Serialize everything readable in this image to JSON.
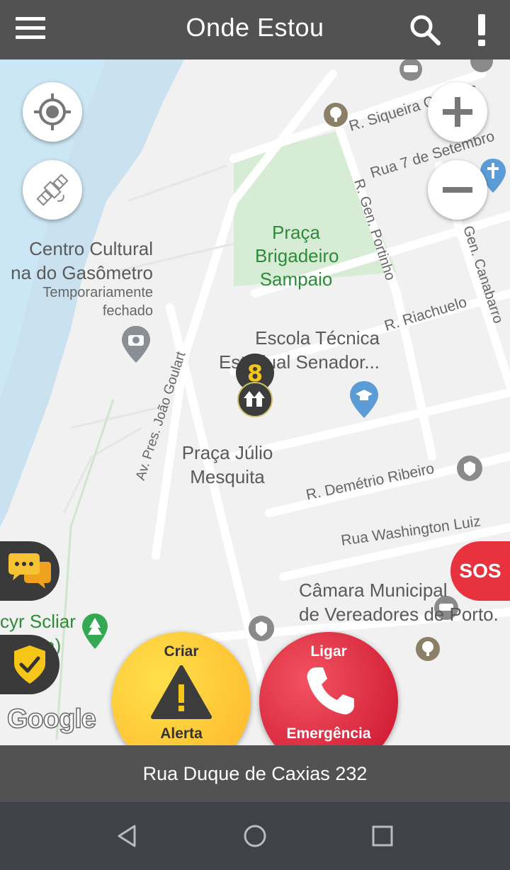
{
  "header": {
    "title": "Onde Estou",
    "menu_icon": "hamburger-menu-icon",
    "search_icon": "search-icon",
    "more_icon": "exclamation-icon"
  },
  "map": {
    "streets": {
      "siqueira_campos": "R. Siqueira Campos",
      "sete_setembro": "Rua 7 de Setembro",
      "gen_portinho": "R. Gen. Portinho",
      "gen_canabarro": "Gen. Canabarro",
      "riachuelo": "R. Riachuelo",
      "joao_goulart": "Av. Pres. João Goulart",
      "demetrio_ribeiro": "R. Demétrio Ribeiro",
      "washington_luiz": "Rua Washington Luiz"
    },
    "places": {
      "praca_brigadeiro": [
        "Praça",
        "Brigadeiro",
        "Sampaio"
      ],
      "centro_cultural": [
        "Centro Cultural",
        "na do Gasômetro"
      ],
      "centro_cultural_status": [
        "Temporariamente",
        "fechado"
      ],
      "escola": [
        "Escola Técnica",
        "Estadual Senador..."
      ],
      "praca_julio": [
        "Praça Júlio",
        "Mesquita"
      ],
      "camara": [
        "Câmara Municipal",
        "de Vereadores de Porto."
      ],
      "scliar": [
        "cyr Scliar",
        "(ha)"
      ]
    },
    "attribution": "Google"
  },
  "controls": {
    "locate_icon": "my-location-icon",
    "satellite_icon": "satellite-icon",
    "zoom_in_icon": "plus-icon",
    "zoom_out_icon": "minus-icon",
    "chat_icon": "chat-bubbles-icon",
    "shield_icon": "shield-check-icon",
    "sos_label": "SOS"
  },
  "actions": {
    "alert": {
      "top": "Criar",
      "bottom": "Alerta",
      "icon": "warning-triangle-icon"
    },
    "call": {
      "top": "Ligar",
      "bottom": "Emergência",
      "icon": "phone-icon"
    }
  },
  "address": "Rua Duque de Caxias 232",
  "colors": {
    "bar": "#525252",
    "sos_red": "#e8323e",
    "alert_yellow": "#fcc22b",
    "call_red": "#d81f36",
    "park_green": "#2e8b3a"
  }
}
